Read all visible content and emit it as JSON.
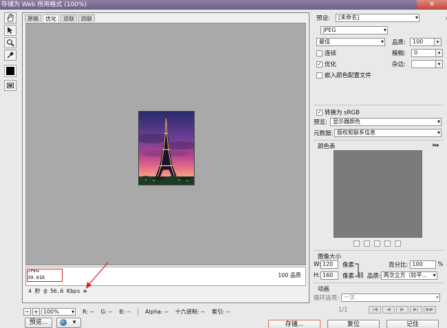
{
  "window": {
    "title": "存储为 Web 所用格式 (100%)",
    "close_label": "✕"
  },
  "tools": [
    {
      "name": "hand-tool",
      "icon": "hand-icon"
    },
    {
      "name": "slice-select-tool",
      "icon": "slice-select-icon"
    },
    {
      "name": "zoom-tool",
      "icon": "zoom-icon"
    },
    {
      "name": "eyedropper-tool",
      "icon": "eyedropper-icon"
    }
  ],
  "tabs": [
    "原稿",
    "优化",
    "双联",
    "四联"
  ],
  "active_tab": "优化",
  "preview": {
    "format": "JPEG",
    "file_size": "39.01K",
    "download_time": "4 秒 @ 56.6 Kbps",
    "download_menu": "≡",
    "quality": "100 品质"
  },
  "statusbar": {
    "zoom": "100%",
    "r": "R: --",
    "g": "G: --",
    "b": "B: --",
    "alpha": "Alpha: --",
    "hex": "十六进制: --",
    "index": "索引: --"
  },
  "bottom": {
    "preview_btn": "预览...",
    "save_btn": "存储...",
    "reset_btn": "复位",
    "remember_btn": "记住"
  },
  "settings": {
    "preset_label": "预设:",
    "preset_value": "[未命名]",
    "format_value": "JPEG",
    "compression_value": "最佳",
    "quality_label": "品质:",
    "quality_value": "100",
    "progressive_label": "连续",
    "progressive_checked": false,
    "blur_label": "模糊:",
    "blur_value": "0",
    "optimized_label": "优化",
    "optimized_checked": true,
    "matte_label": "杂边:",
    "embed_profile_label": "嵌入颜色配置文件",
    "embed_profile_checked": false,
    "convert_srgb_label": "转换为 sRGB",
    "convert_srgb_checked": true,
    "preview_label": "预览:",
    "preview_value": "显示器颜色",
    "metadata_label": "元数据:",
    "metadata_value": "版权和联系信息"
  },
  "color_table": {
    "title": "颜色表"
  },
  "image_size": {
    "title": "图像大小",
    "w_label": "W:",
    "w_value": "120",
    "h_label": "H:",
    "h_value": "160",
    "unit": "像素",
    "percent_label": "百分比:",
    "percent_value": "100",
    "percent_unit": "%",
    "quality_label": "品质:",
    "quality_value": "两次立方（较平..."
  },
  "animation": {
    "title": "动画",
    "loop_label": "循环选项:",
    "loop_value": "一次",
    "frame": "1/1"
  }
}
